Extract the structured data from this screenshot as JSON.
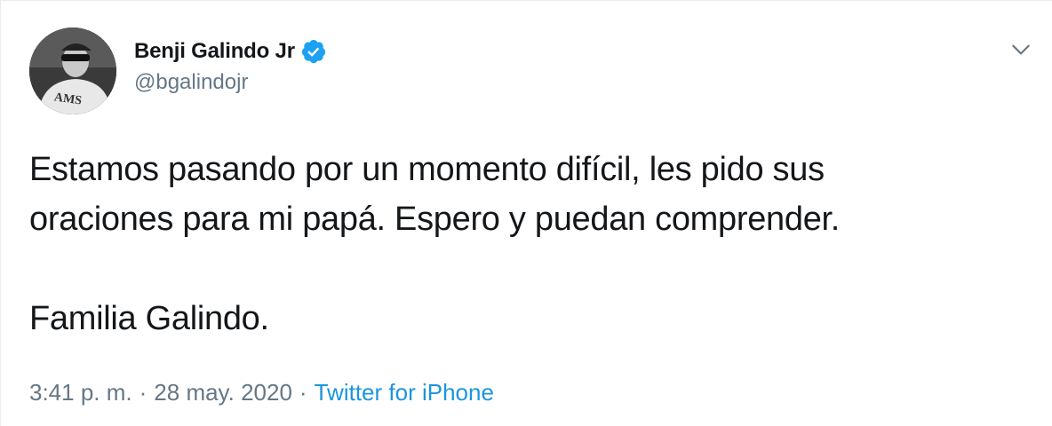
{
  "tweet": {
    "author": {
      "display_name": "Benji Galindo Jr",
      "handle": "@bgalindojr",
      "verified": true
    },
    "text": "Estamos pasando por un momento difícil, les pido sus\noraciones para mi papá. Espero y puedan comprender.\n\nFamilia Galindo.",
    "time": "3:41 p. m.",
    "separator": "·",
    "date": "28 may. 2020",
    "source": "Twitter for iPhone"
  },
  "colors": {
    "text": "#14171a",
    "secondary": "#657786",
    "accent": "#1b95e0",
    "verified_badge": "#1da1f2"
  },
  "icons": {
    "verified": "verified-badge-icon",
    "more": "chevron-down-icon"
  }
}
